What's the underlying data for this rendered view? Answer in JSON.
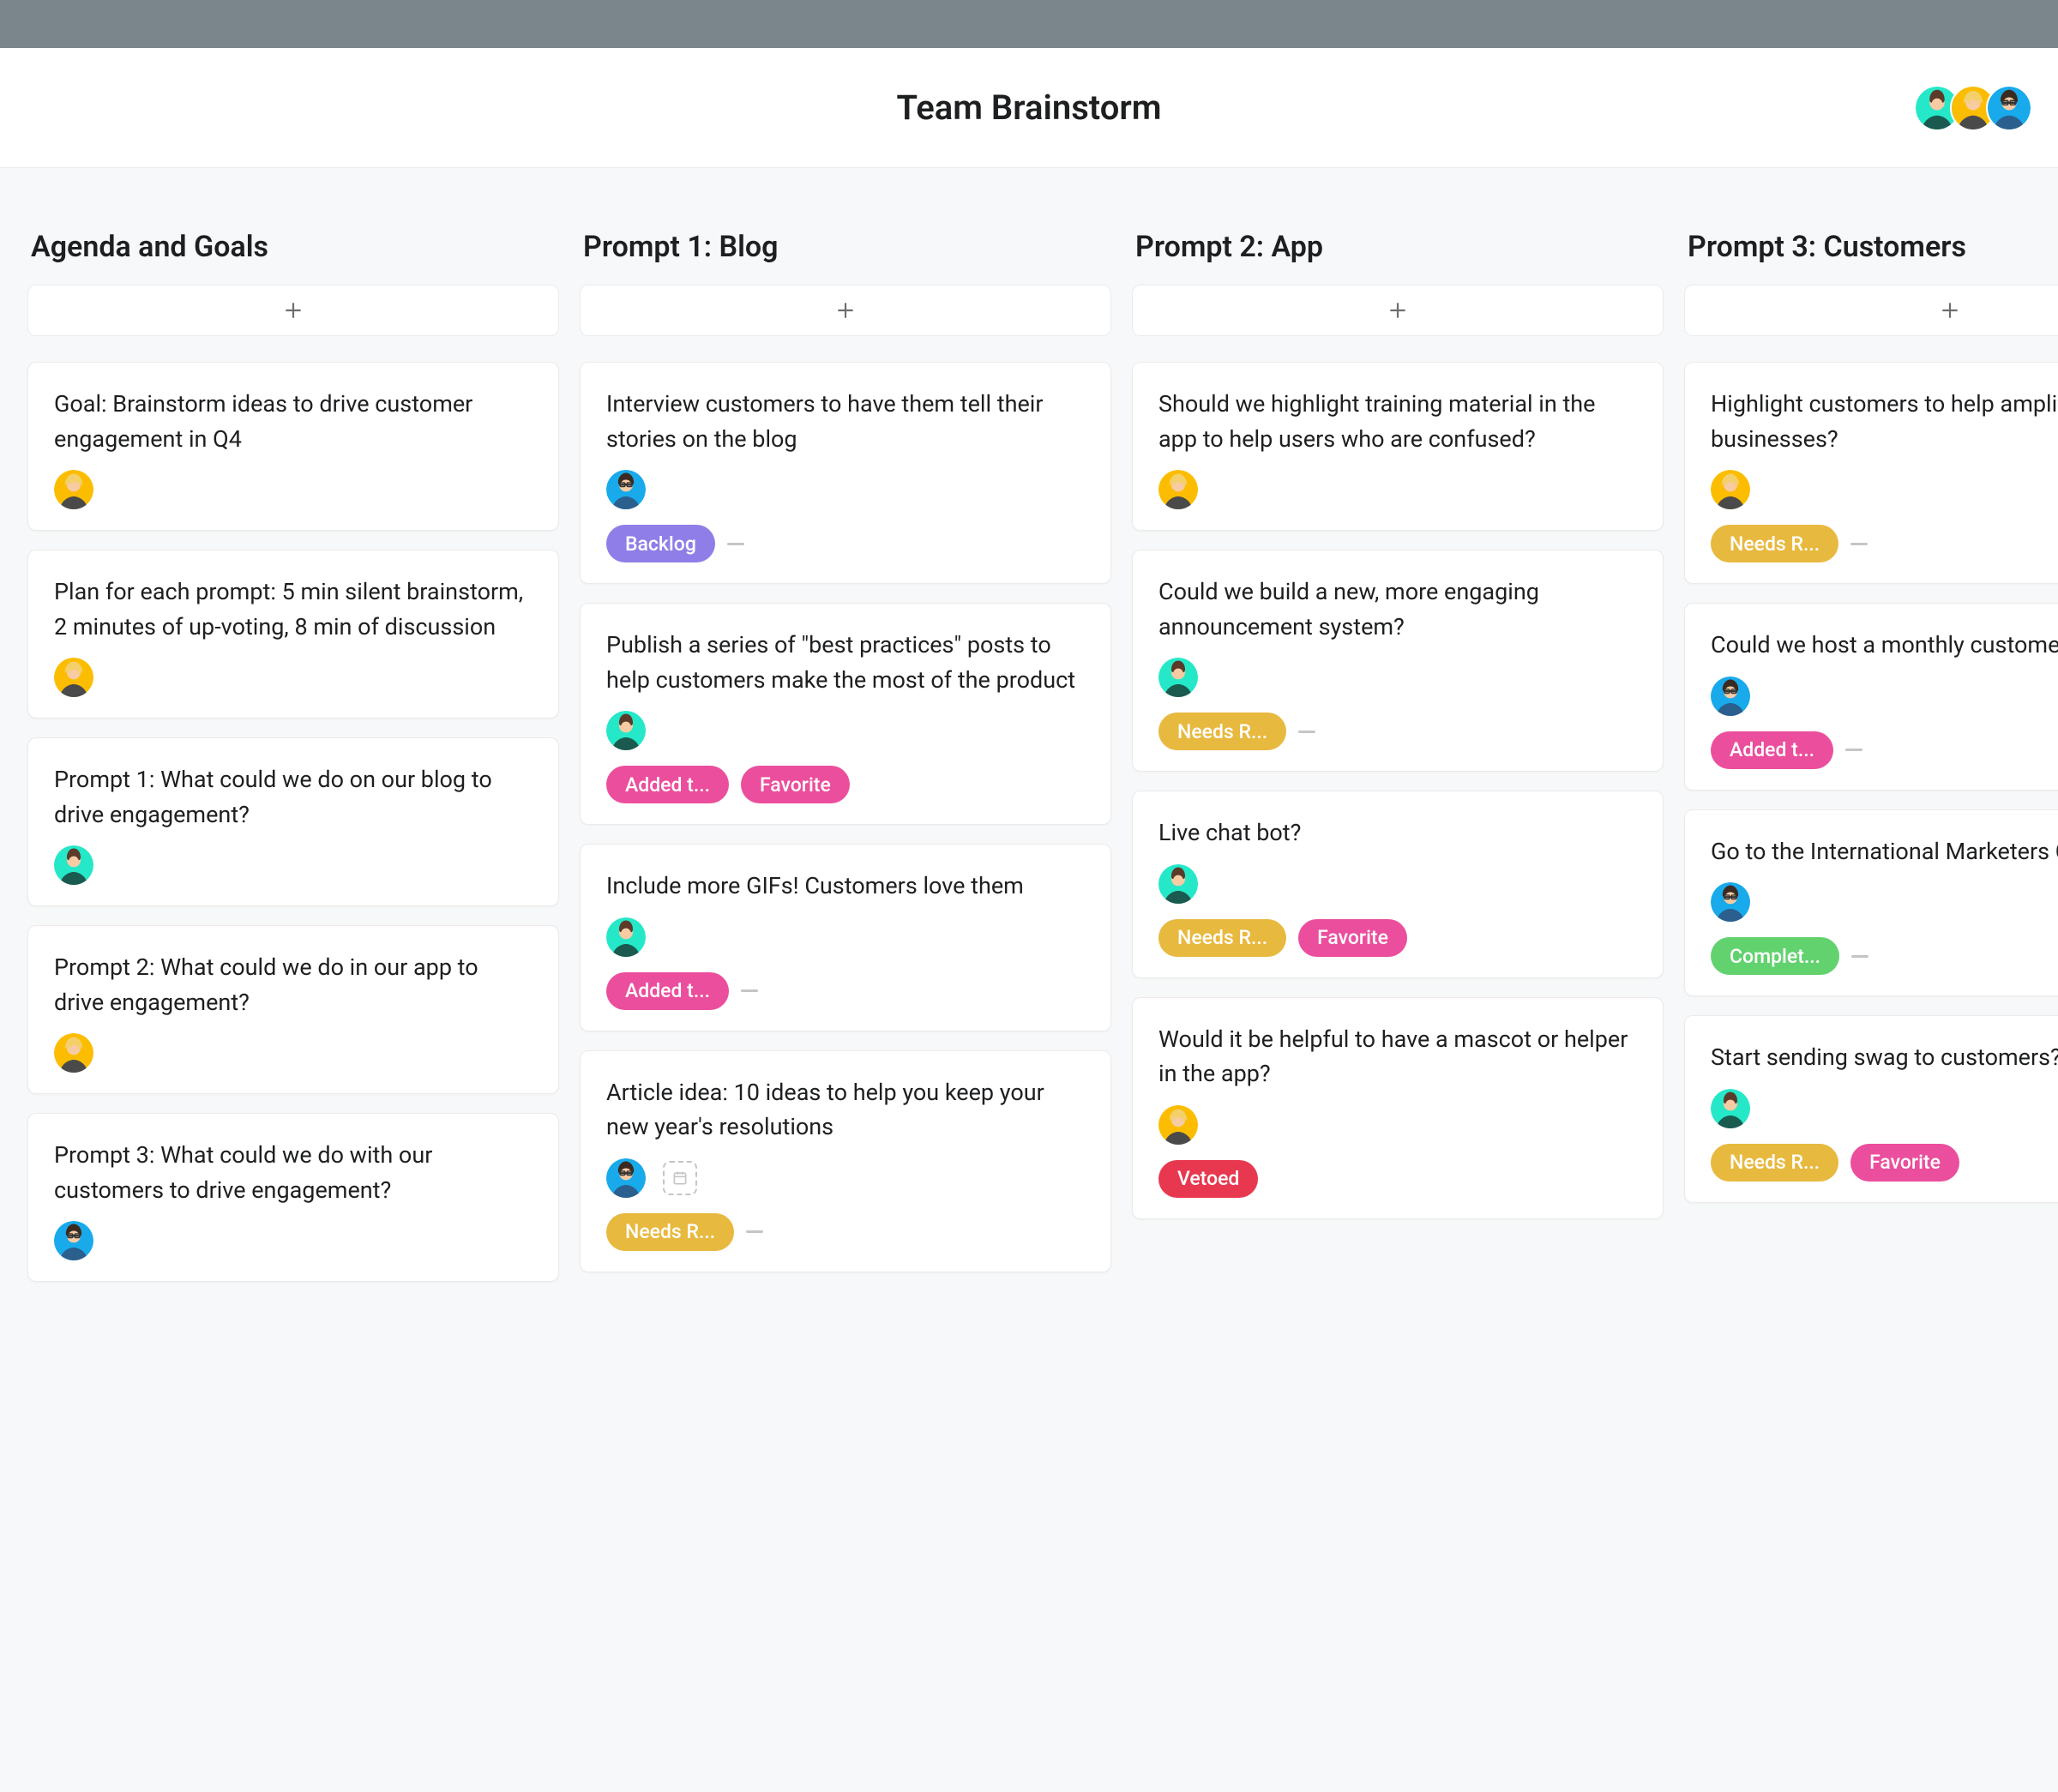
{
  "header": {
    "title": "Team Brainstorm"
  },
  "header_avatars": [
    "green",
    "yellow",
    "blue"
  ],
  "tag_colors": {
    "Backlog": "tag-backlog",
    "Added t...": "tag-added",
    "Favorite": "tag-favorite",
    "Needs R...": "tag-needs",
    "Vetoed": "tag-vetoed",
    "Complet...": "tag-complete"
  },
  "columns": [
    {
      "title": "Agenda and Goals",
      "cards": [
        {
          "title": "Goal: Brainstorm ideas to drive customer engagement in Q4",
          "avatar": "yellow",
          "tags": []
        },
        {
          "title": "Plan for each prompt: 5 min silent brainstorm, 2 minutes of up-voting, 8 min of discussion",
          "avatar": "yellow",
          "tags": []
        },
        {
          "title": "Prompt 1: What could we do on our blog to drive engagement?",
          "avatar": "green",
          "tags": []
        },
        {
          "title": "Prompt 2: What could we do in our app to drive engagement?",
          "avatar": "yellow",
          "tags": []
        },
        {
          "title": "Prompt 3: What could we do with our customers to drive engagement?",
          "avatar": "blue",
          "tags": []
        }
      ]
    },
    {
      "title": "Prompt 1: Blog",
      "cards": [
        {
          "title": "Interview customers to have them tell their stories on the blog",
          "avatar": "blue",
          "tags": [
            "Backlog"
          ],
          "trailing_dash": true
        },
        {
          "title": "Publish a series of \"best practices\" posts to help customers make the most of the product",
          "avatar": "green",
          "tags": [
            "Added t...",
            "Favorite"
          ]
        },
        {
          "title": "Include more GIFs! Customers love them",
          "avatar": "green",
          "tags": [
            "Added t..."
          ],
          "trailing_dash": true
        },
        {
          "title": "Article idea: 10 ideas to help you keep your new year's resolutions",
          "avatar": "blue",
          "subtask": true,
          "tags": [
            "Needs R..."
          ],
          "trailing_dash": true
        }
      ]
    },
    {
      "title": "Prompt 2: App",
      "cards": [
        {
          "title": "Should we highlight training material in the app to help users who are confused?",
          "avatar": "yellow",
          "tags": []
        },
        {
          "title": "Could we build a new, more engaging announcement system?",
          "avatar": "green",
          "tags": [
            "Needs R..."
          ],
          "trailing_dash": true
        },
        {
          "title": "Live chat bot?",
          "avatar": "green",
          "tags": [
            "Needs R...",
            "Favorite"
          ]
        },
        {
          "title": "Would it be helpful to have a mascot or helper in the app?",
          "avatar": "yellow",
          "tags": [
            "Vetoed"
          ]
        }
      ]
    },
    {
      "title": "Prompt 3: Customers",
      "cards": [
        {
          "title": "Highlight customers to help amplify their businesses?",
          "avatar": "yellow",
          "tags": [
            "Needs R..."
          ],
          "trailing_dash": true
        },
        {
          "title": "Could we host a monthly customer meet up?",
          "avatar": "blue",
          "tags": [
            "Added t..."
          ],
          "trailing_dash": true
        },
        {
          "title": "Go to the International Marketers Conference?",
          "avatar": "blue",
          "tags": [
            "Complet..."
          ],
          "trailing_dash": true
        },
        {
          "title": "Start sending swag to customers?",
          "avatar": "green",
          "tags": [
            "Needs R...",
            "Favorite"
          ]
        }
      ]
    }
  ]
}
